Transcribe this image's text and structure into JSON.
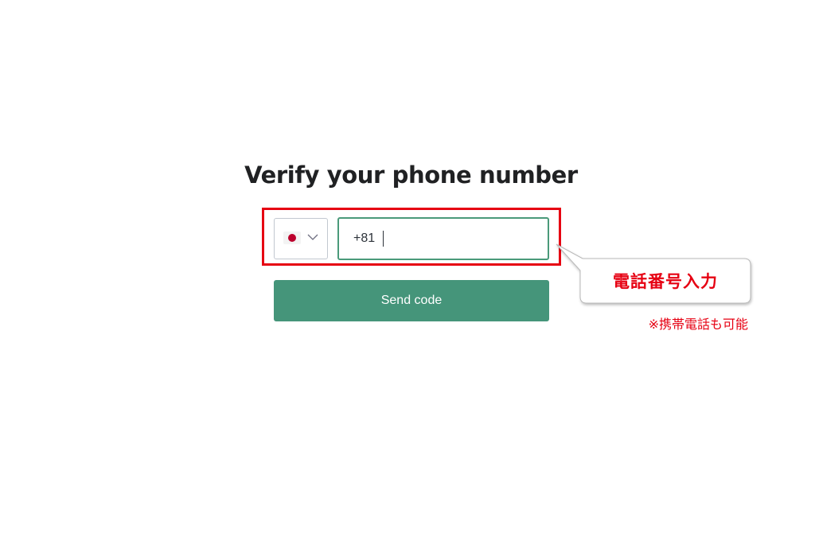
{
  "header": {
    "title": "Verify your phone number"
  },
  "phone_form": {
    "country": {
      "flag_icon": "japan-flag-icon",
      "flag_colors": {
        "field": "#f3f3f3",
        "disc": "#bc002d"
      },
      "dropdown_icon": "chevron-down-icon"
    },
    "phone_value": "+81 ",
    "input_border_color": "#4a9a7a"
  },
  "actions": {
    "send_code_label": "Send code",
    "button_color": "#45957a"
  },
  "annotation": {
    "callout_label": "電話番号入力",
    "note": "※携帯電話も可能",
    "accent_color": "#e60012"
  }
}
